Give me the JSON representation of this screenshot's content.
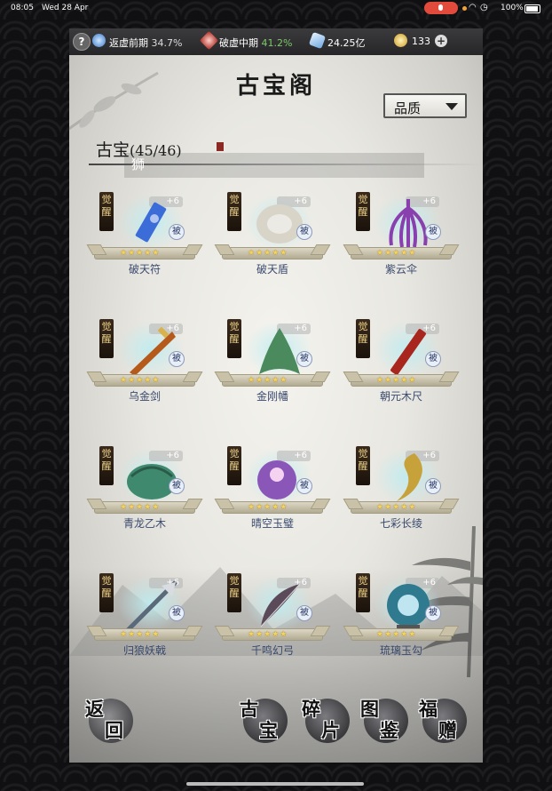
{
  "status_bar": {
    "time": "08:05",
    "date": "Wed 28 Apr",
    "battery": "100%"
  },
  "resource_bar": {
    "help": "?",
    "realm1_label": "返虚前期",
    "realm1_pct": "34.7%",
    "realm2_label": "破虚中期",
    "realm2_pct": "41.2%",
    "spirit_stones": "24.25亿",
    "currency": "133",
    "plus": "+"
  },
  "page_title": "古宝阁",
  "quality_filter": "品质",
  "section": {
    "title": "古宝",
    "count": "(45/46)"
  },
  "overlay_text": "狮",
  "treasures": [
    {
      "name": "破天符",
      "level": "+6",
      "awaken": "觉醒",
      "passive": "被",
      "stars": "★★★★★",
      "icon": "talisman-icon",
      "color": "#3b6cd8"
    },
    {
      "name": "破天盾",
      "level": "+6",
      "awaken": "觉醒",
      "passive": "被",
      "stars": "★★★★★",
      "icon": "shield-icon",
      "color": "#d9d4c8"
    },
    {
      "name": "紫云伞",
      "level": "+6",
      "awaken": "觉醒",
      "passive": "被",
      "stars": "★★★★★",
      "icon": "umbrella-icon",
      "color": "#8a3fae"
    },
    {
      "name": "乌金剑",
      "level": "+6",
      "awaken": "觉醒",
      "passive": "被",
      "stars": "★★★★★",
      "icon": "sword-icon",
      "color": "#b65a1c"
    },
    {
      "name": "金刚幡",
      "level": "+6",
      "awaken": "觉醒",
      "passive": "被",
      "stars": "★★★★★",
      "icon": "banner-icon",
      "color": "#4a8a5c"
    },
    {
      "name": "朝元木尺",
      "level": "+6",
      "awaken": "觉醒",
      "passive": "被",
      "stars": "★★★★★",
      "icon": "ruler-icon",
      "color": "#a8261e"
    },
    {
      "name": "青龙乙木",
      "level": "+6",
      "awaken": "觉醒",
      "passive": "被",
      "stars": "★★★★★",
      "icon": "dragon-wood-icon",
      "color": "#3f8a6e"
    },
    {
      "name": "晴空玉璧",
      "level": "+6",
      "awaken": "觉醒",
      "passive": "被",
      "stars": "★★★★★",
      "icon": "jade-disc-icon",
      "color": "#8a56b8"
    },
    {
      "name": "七彩长绫",
      "level": "+6",
      "awaken": "觉醒",
      "passive": "被",
      "stars": "★★★★★",
      "icon": "ribbon-icon",
      "color": "#c7a23a"
    },
    {
      "name": "归狼妖戟",
      "level": "+6",
      "awaken": "觉醒",
      "passive": "被",
      "stars": "★★★★★",
      "icon": "halberd-icon",
      "color": "#5a6a7a"
    },
    {
      "name": "千鸣幻弓",
      "level": "+6",
      "awaken": "觉醒",
      "passive": "被",
      "stars": "★★★★★",
      "icon": "bow-icon",
      "color": "#5a4a5a"
    },
    {
      "name": "琉璃玉勾",
      "level": "+6",
      "awaken": "觉醒",
      "passive": "被",
      "stars": "★★★★★",
      "icon": "jade-hook-icon",
      "color": "#2f7a8e"
    }
  ],
  "nav": {
    "back": {
      "a": "返",
      "b": "回"
    },
    "treasure": {
      "a": "古",
      "b": "宝"
    },
    "fragments": {
      "a": "碎",
      "b": "片"
    },
    "codex": {
      "a": "图",
      "b": "鉴"
    },
    "gift": {
      "a": "福",
      "b": "赠"
    }
  }
}
